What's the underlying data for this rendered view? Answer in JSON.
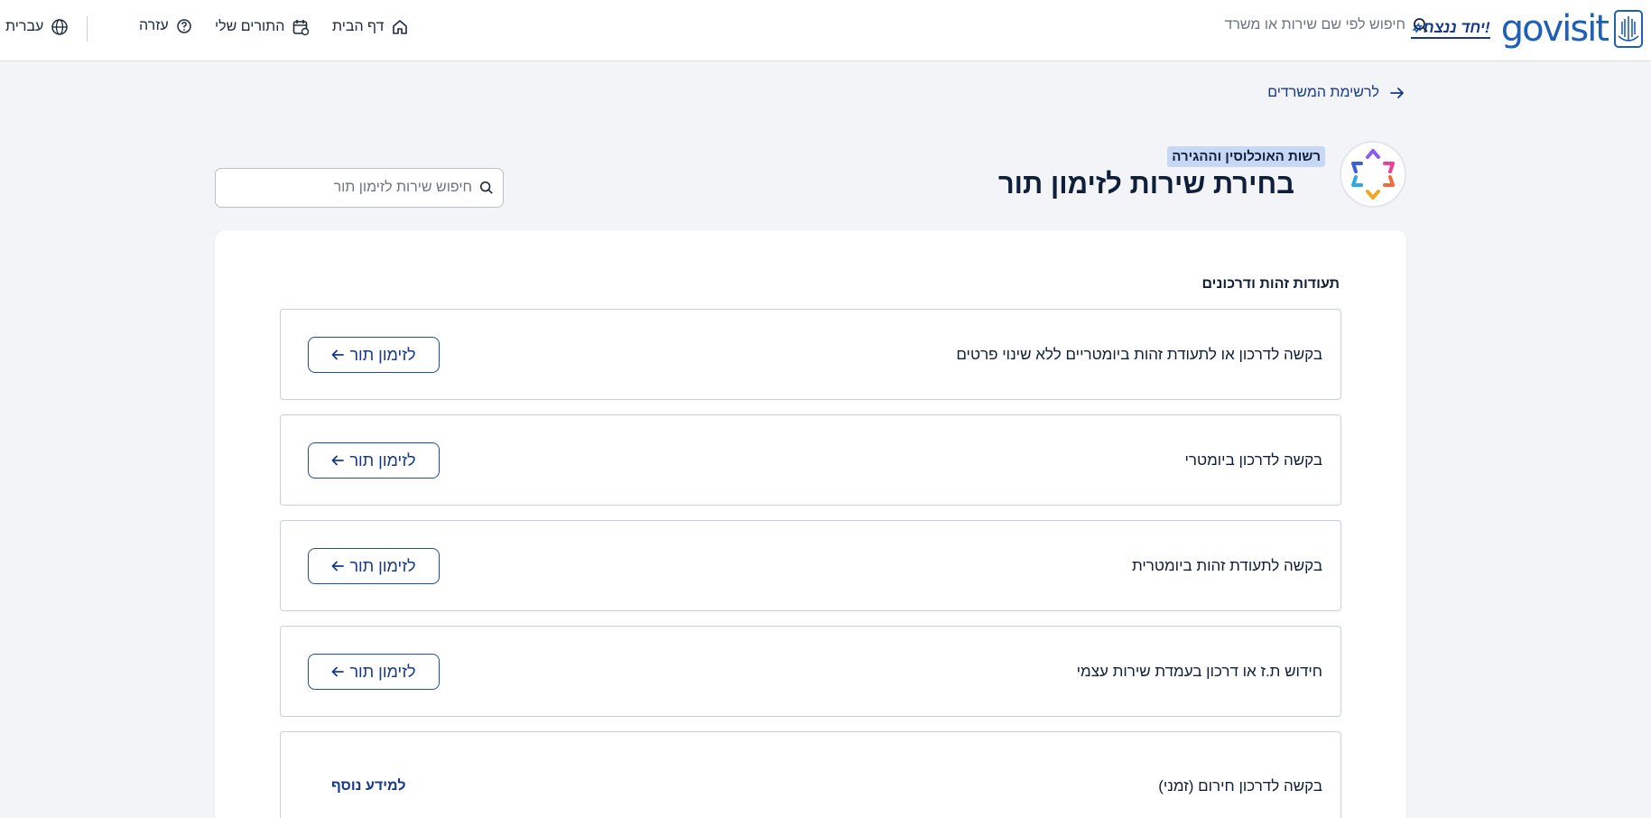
{
  "header": {
    "brand": "govisit",
    "slogan": "יחד ננצח!",
    "search_placeholder": "חיפוש לפי שם שירות או משרד",
    "nav": {
      "home": "דף הבית",
      "my_appointments": "התורים שלי",
      "help": "עזרה",
      "language": "עברית"
    }
  },
  "back_link": "לרשימת המשרדים",
  "office": {
    "name": "רשות האוכלוסין וההגירה"
  },
  "page_title": "בחירת שירות לזימון תור",
  "service_search": {
    "placeholder": "חיפוש שירות לזימון תור"
  },
  "section": {
    "title": "תעודות זהות ודרכונים",
    "services": [
      {
        "name": "בקשה לדרכון או לתעודת זהות ביומטריים ללא שינוי פרטים",
        "action": "לזימון תור"
      },
      {
        "name": "בקשה לדרכון ביומטרי",
        "action": "לזימון תור"
      },
      {
        "name": "בקשה לתעודת זהות ביומטרית",
        "action": "לזימון תור"
      },
      {
        "name": "חידוש ת.ז או דרכון בעמדת שירות עצמי",
        "action": "לזימון תור"
      },
      {
        "name": "בקשה לדרכון חירום (זמני)",
        "action": "למידע נוסף"
      }
    ]
  },
  "colors": {
    "primary": "#14398a",
    "brand_blue": "#1f5fb8",
    "page_bg": "#f2f4f8",
    "tag_bg": "#c7d8f4"
  },
  "icons": {
    "search": "search-icon",
    "home": "home-icon",
    "calendar": "calendar-icon",
    "help": "help-icon",
    "globe": "globe-icon",
    "arrow_right": "arrow-right-icon",
    "arrow_left": "arrow-left-icon",
    "emblem": "state-emblem-icon",
    "office_logo": "star-of-david-logo-icon"
  }
}
